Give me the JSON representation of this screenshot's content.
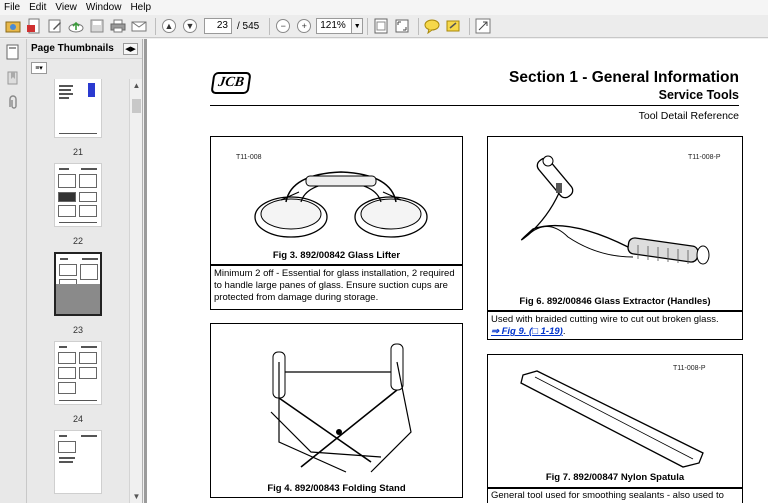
{
  "menu": [
    "File",
    "Edit",
    "View",
    "Window",
    "Help"
  ],
  "toolbar": {
    "current_page": "23",
    "page_total": "/ 545",
    "zoom": "121%",
    "icons": [
      "open-icon",
      "create-pdf-icon",
      "edit-icon",
      "cloud-icon",
      "save-icon",
      "print-icon",
      "email-icon",
      "previous-page-icon",
      "next-page-icon",
      "zoom-out-icon",
      "zoom-in-icon",
      "fit-page-icon",
      "full-screen-icon",
      "comment-icon",
      "highlight-icon",
      "expand-icon"
    ]
  },
  "thumbnails": {
    "title": "Page Thumbnails",
    "pages": [
      "21",
      "22",
      "23",
      "24"
    ],
    "selected": "23"
  },
  "page": {
    "logo": "JCB",
    "section_title": "Section 1 - General Information",
    "section_subtitle": "Service Tools",
    "reference": "Tool Detail Reference",
    "figures": [
      {
        "tag": "T11-008",
        "caption": "Fig 3. 892/00842 Glass Lifter",
        "description": "Minimum 2 off - Essential for glass installation, 2 required to handle large panes of glass. Ensure suction cups are protected from damage during storage."
      },
      {
        "tag": "T11-008-P",
        "caption": "Fig 6. 892/00846 Glass Extractor (Handles)",
        "description": "Used with braided cutting wire to cut out broken glass.",
        "link_text": "Fig 9.",
        "link_ref": "1-19"
      },
      {
        "tag": "",
        "caption": "Fig 4. 892/00843 Folding Stand",
        "description": ""
      },
      {
        "tag": "T11-008-P",
        "caption": "Fig 7. 892/00847 Nylon Spatula",
        "description": "General tool used for smoothing sealants - also used to"
      }
    ]
  },
  "colors": {
    "link": "#0033cc",
    "doc_background": "#9b9b9b",
    "panel": "#e9e9e9"
  }
}
